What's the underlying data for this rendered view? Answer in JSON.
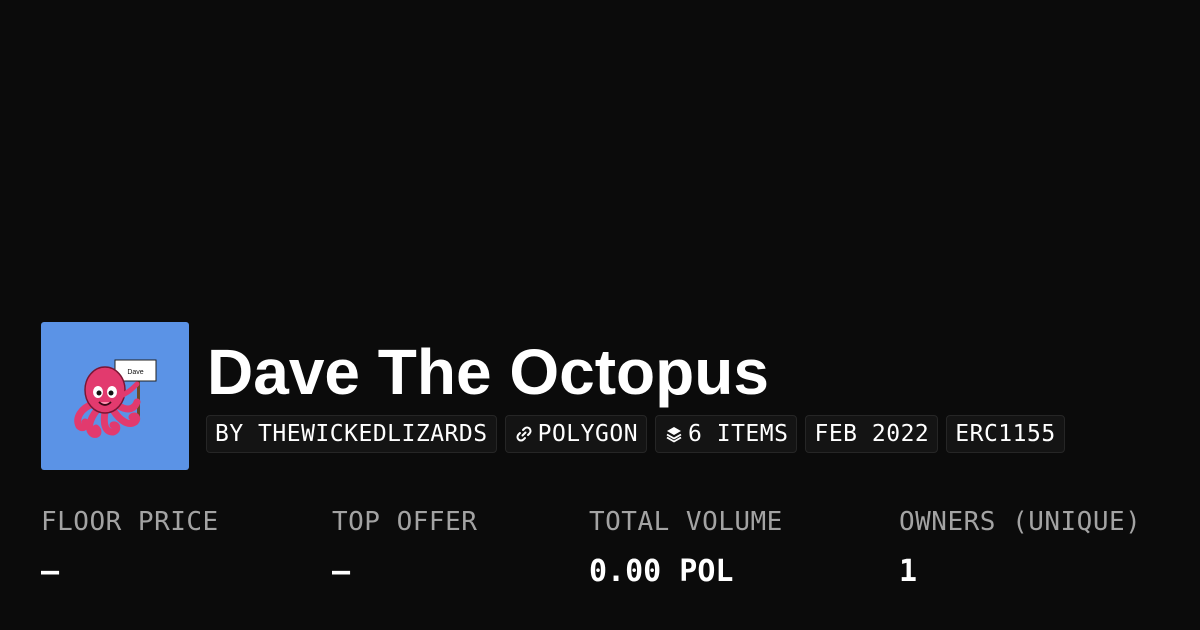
{
  "collection": {
    "name": "Dave The Octopus",
    "image_sign_text": "Dave",
    "colors": {
      "background": "#0b0b0b",
      "avatar_background": "#5b93e6",
      "octopus": "#e23a6e"
    }
  },
  "tags": [
    {
      "label": "BY THEWICKEDLIZARDS",
      "icon": null
    },
    {
      "label": "POLYGON",
      "icon": "link-icon"
    },
    {
      "label": "6 ITEMS",
      "icon": "layers-icon"
    },
    {
      "label": "FEB 2022",
      "icon": null
    },
    {
      "label": "ERC1155",
      "icon": null
    }
  ],
  "stats": [
    {
      "label": "FLOOR PRICE",
      "value": "–"
    },
    {
      "label": "TOP OFFER",
      "value": "–"
    },
    {
      "label": "TOTAL VOLUME",
      "value": "0.00 POL"
    },
    {
      "label": "OWNERS (UNIQUE)",
      "value": "1"
    }
  ]
}
